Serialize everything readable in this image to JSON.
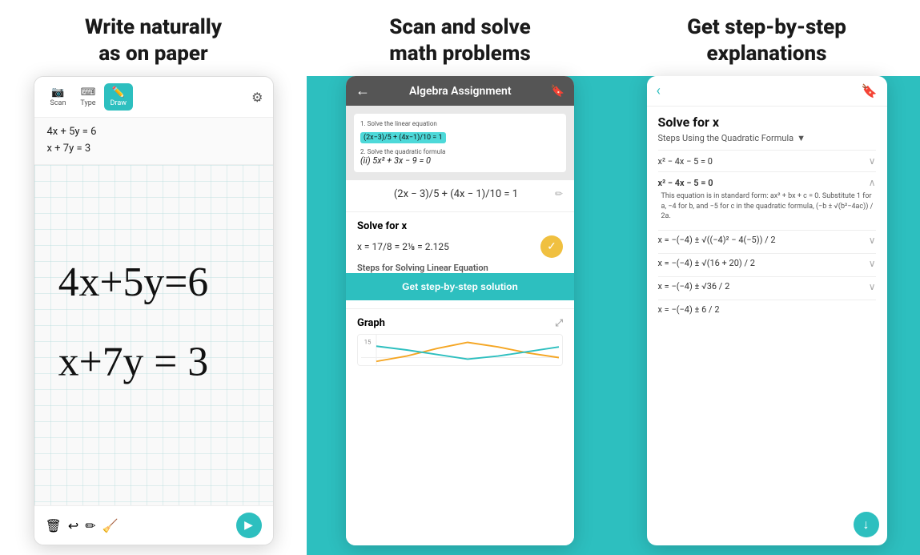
{
  "header": {
    "col1": {
      "line1": "Write naturally",
      "line2": "as on paper"
    },
    "col2": {
      "line1": "Scan and solve",
      "line2": "math problems"
    },
    "col3": {
      "line1": "Get step-by-step",
      "line2": "explanations"
    }
  },
  "panel1": {
    "toolbar": {
      "scan_label": "Scan",
      "type_label": "Type",
      "draw_label": "Draw"
    },
    "math_line1": "4x + 5y = 6",
    "math_line2": "x + 7y = 3"
  },
  "panel2": {
    "header": {
      "back": "←",
      "title": "Algebra Assignment",
      "bookmark": "🔖"
    },
    "doc": {
      "task1": "1. Solve the linear equation",
      "equation_display": "(2x−3)/5 + (4x−1)/10 = 1",
      "task2": "2. Solve the quadratic formula",
      "partial": "(ii) 5x² + 3x − 9 = 0"
    },
    "result_eq": "(2x − 3)/5 + (4x − 1)/10 = 1",
    "solve_title": "Solve for x",
    "solve_value": "x = 17/8 = 2⅛ = 2.125",
    "steps_label": "Steps for Solving Linear Equation",
    "step_btn": "Get step-by-step solution",
    "graph_title": "Graph",
    "graph_num": "15"
  },
  "panel3": {
    "solve_for": "Solve for x",
    "method": "Steps Using the Quadratic Formula",
    "steps": [
      {
        "eq": "x² − 4x − 5 = 0",
        "expanded": false
      },
      {
        "eq": "x² − 4x − 5 = 0",
        "expanded": true
      },
      {
        "eq": "x = −(−4) ± √((−4)² − 4(−5)) / 2"
      },
      {
        "eq": "x = −(−4) ± √(16 + 20) / 2"
      },
      {
        "eq": "x = −(−4) ± √36 / 2"
      },
      {
        "eq": "x = −(−4) ± 6 / 2"
      }
    ],
    "explanation": "This equation is in standard form: ax² + bx + c = 0. Substitute 1 for a, −4 for b, and −5 for c in the quadratic formula, (−b ± √(b²−4ac)) / 2a.",
    "fab_icon": "↓"
  }
}
